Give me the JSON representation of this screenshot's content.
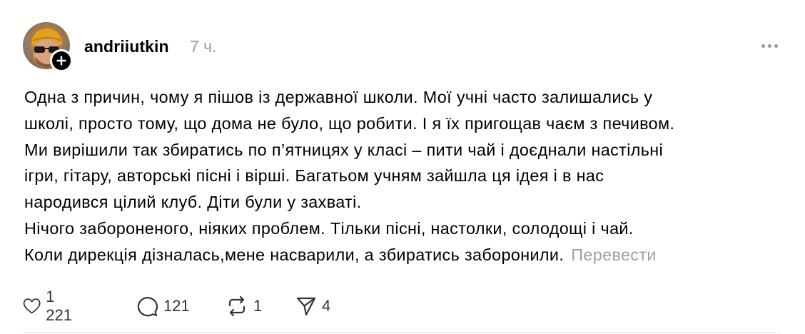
{
  "post": {
    "author": "andriiutkin",
    "time": "7 ч.",
    "text_lines": [
      "Одна з причин, чому я пішов із державної школи. Мої учні часто залишались у",
      "школі, просто тому, що дома не було, що робити. І я їх пригощав чаєм з печивом.",
      "Ми вирішили так збиратись по п’ятницях у класі – пити чай і доєднали настільні",
      "ігри, гітару, авторські пісні і вірші. Багатьом учням зайшла ця ідея і в нас",
      "народився цілий клуб. Діти були у захваті.",
      "Нічого забороненого, ніяких проблем. Тільки пісні, настолки, солодощі і чай.",
      "Коли дирекція дізналась,мене насварили, а збиратись заборонили."
    ],
    "translate_label": "Перевести"
  },
  "actions": {
    "likes": "1 221",
    "replies": "121",
    "reposts": "1",
    "shares": "4"
  },
  "icons": {
    "avatar_badge": "plus-icon",
    "menu": "more-icon",
    "like": "heart-icon",
    "reply": "comment-icon",
    "repost": "repost-icon",
    "share": "send-icon"
  },
  "colors": {
    "text": "#000000",
    "muted": "#999999",
    "badge": "#000000"
  }
}
